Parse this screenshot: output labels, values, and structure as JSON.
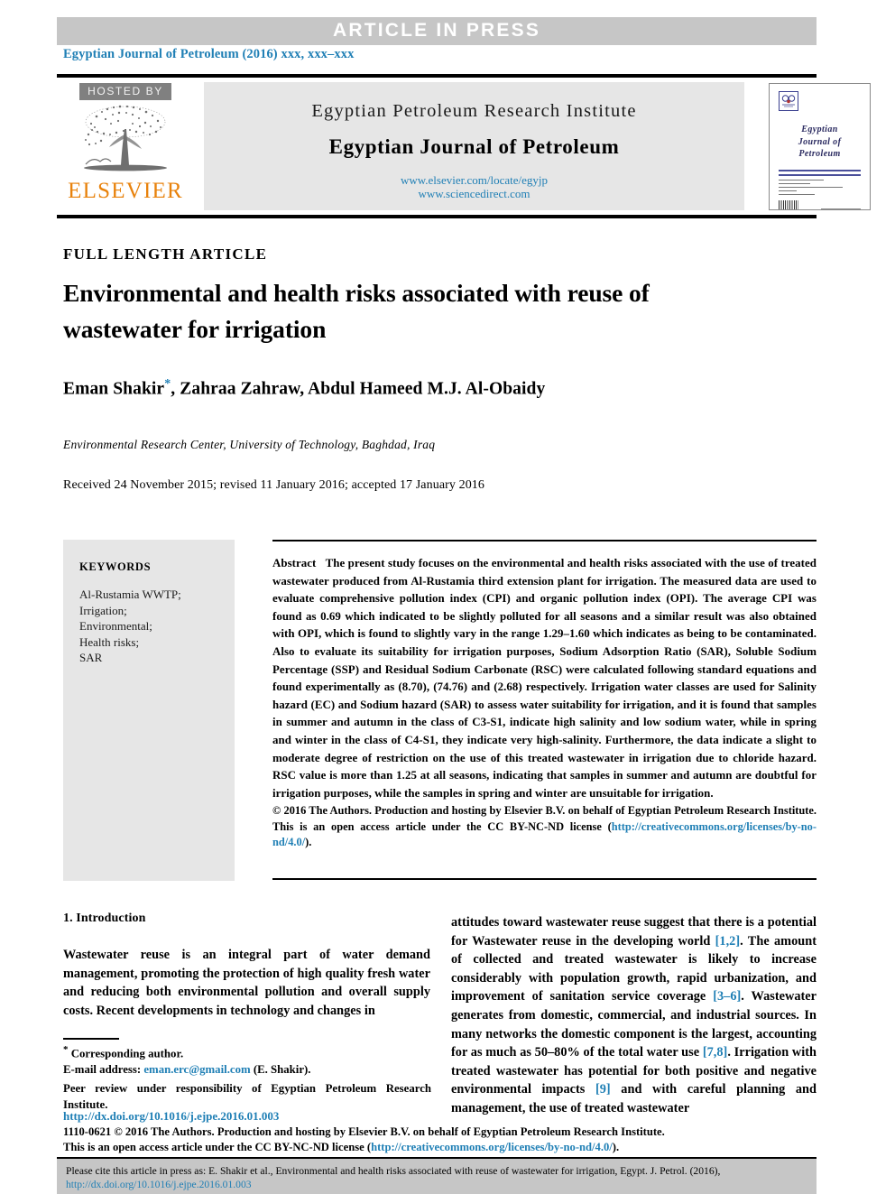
{
  "banner": {
    "label": "ARTICLE IN PRESS"
  },
  "journal_line": "Egyptian Journal of Petroleum (2016) xxx, xxx–xxx",
  "masthead": {
    "hosted_by": "HOSTED BY",
    "publisher": "ELSEVIER",
    "institute": "Egyptian Petroleum Research Institute",
    "journal": "Egyptian Journal of Petroleum",
    "url_locate": "www.elsevier.com/locate/egyjp",
    "url_sciencedirect": "www.sciencedirect.com",
    "cover": {
      "line1": "Egyptian",
      "line2": "Journal of",
      "line3": "Petroleum"
    }
  },
  "article": {
    "type_label": "FULL LENGTH ARTICLE",
    "title": "Environmental and health risks associated with reuse of wastewater for irrigation",
    "authors_pre": "Eman Shakir",
    "authors_post": ", Zahraa Zahraw, Abdul Hameed M.J. Al-Obaidy",
    "affiliation": "Environmental Research Center, University of Technology, Baghdad, Iraq",
    "dates": "Received 24 November 2015; revised 11 January 2016; accepted 17 January 2016"
  },
  "keywords": {
    "title": "KEYWORDS",
    "items": "Al-Rustamia WWTP; Irrigation; Environmental; Health risks; SAR"
  },
  "abstract": {
    "label": "Abstract",
    "text": "The present study focuses on the environmental and health risks associated with the use of treated wastewater produced from Al-Rustamia third extension plant for irrigation. The measured data are used to evaluate comprehensive pollution index (CPI) and organic pollution index (OPI). The average CPI was found as 0.69 which indicated to be slightly polluted for all seasons and a similar result was also obtained with OPI, which is found to slightly vary in the range 1.29–1.60 which indicates as being to be contaminated. Also to evaluate its suitability for irrigation purposes, Sodium Adsorption Ratio (SAR), Soluble Sodium Percentage (SSP) and Residual Sodium Carbonate (RSC) were calculated following standard equations and found experimentally as (8.70), (74.76) and (2.68) respectively. Irrigation water classes are used for Salinity hazard (EC) and Sodium hazard (SAR) to assess water suitability for irrigation, and it is found that samples in summer and autumn in the class of C3-S1, indicate high salinity and low sodium water, while in spring and winter in the class of C4-S1, they indicate very high-salinity. Furthermore, the data indicate a slight to moderate degree of restriction on the use of this treated wastewater in irrigation due to chloride hazard. RSC value is more than 1.25 at all seasons, indicating that samples in summer and autumn are doubtful for irrigation purposes, while the samples in spring and winter are unsuitable for irrigation.",
    "copyright_pre": "© 2016 The Authors. Production and hosting by Elsevier B.V. on behalf of Egyptian Petroleum Research Institute.  This is an open access article under the CC BY-NC-ND license (",
    "copyright_link": "http://creativecommons.org/licenses/by-no-nd/4.0/",
    "copyright_post": ")."
  },
  "body": {
    "section_title": "1. Introduction",
    "left_paragraph": "Wastewater reuse is an integral part of water demand management, promoting the protection of high quality fresh water and reducing both environmental pollution and overall supply costs. Recent developments in technology and changes in",
    "right_paragraph_1": "attitudes toward wastewater reuse suggest that there is a potential for Wastewater reuse in the developing world ",
    "ref_1_2": "[1,2]",
    "right_paragraph_2": ". The amount of collected and treated wastewater is likely to increase considerably with population growth, rapid urbanization, and improvement of sanitation service coverage ",
    "ref_3_6": "[3–6]",
    "right_paragraph_3": ". Wastewater generates from domestic, commercial, and industrial sources. In many networks the domestic component is the largest, accounting for as much as 50–80% of the total water use ",
    "ref_7_8": "[7,8]",
    "right_paragraph_4": ". Irrigation with treated wastewater has potential for both positive and negative environmental impacts ",
    "ref_9": "[9]",
    "right_paragraph_5": " and with careful planning and management, the use of treated wastewater"
  },
  "footnotes": {
    "corresponding": "Corresponding author.",
    "email_label": "E-mail address: ",
    "email": "eman.erc@gmail.com",
    "email_suffix": " (E. Shakir).",
    "peer_review": "Peer review under responsibility of Egyptian Petroleum Research Institute.",
    "doi": "http://dx.doi.org/10.1016/j.ejpe.2016.01.003",
    "issn_line": "1110-0621 © 2016 The Authors. Production and hosting by Elsevier B.V. on behalf of Egyptian Petroleum Research Institute.",
    "license_pre": "This is an open access article under the CC BY-NC-ND license (",
    "license_link": "http://creativecommons.org/licenses/by-no-nd/4.0/",
    "license_post": ")."
  },
  "cite_bar": {
    "text_pre": "Please cite this article in press as: E. Shakir et al., Environmental and health risks associated with reuse of wastewater for irrigation,  Egypt. J. Petrol. (2016), ",
    "link": "http://dx.doi.org/10.1016/j.ejpe.2016.01.003"
  },
  "colors": {
    "link": "#1f7fb5",
    "banner_bg": "#c6c6c6",
    "panel_bg": "#e6e6e6",
    "elsevier_orange": "#e8820c"
  }
}
